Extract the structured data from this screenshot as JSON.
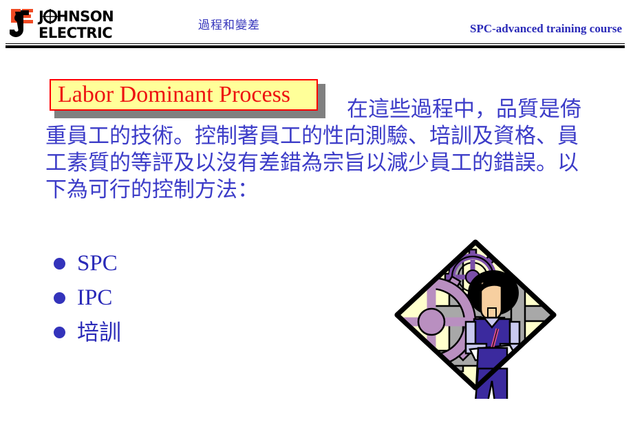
{
  "slide": {
    "header": {
      "logo_name": "johnson-electric-logo",
      "logo_line1": "JOHNSON",
      "logo_line2": "ELECTRIC",
      "center_title": "過程和變差",
      "right_title": "SPC-advanced training course"
    },
    "title": {
      "text": "Labor Dominant Process",
      "text_color": "#ee1111",
      "box_fill": "#ffff99",
      "box_border": "#ff0000",
      "shadow_color": "#808080"
    },
    "body": {
      "paragraph": "在這些過程中，品質是倚重員工的技術。控制著員工的性向測驗、培訓及資格、員工素質的等評及以沒有差錯為宗旨以減少員工的錯誤。以下為可行的控制方法：",
      "text_color": "#3c3cc8"
    },
    "bullets": {
      "marker_color": "#3333bb",
      "items": [
        {
          "label": "SPC",
          "cjk": false
        },
        {
          "label": "IPC",
          "cjk": false
        },
        {
          "label": "培訓",
          "cjk": true
        }
      ]
    },
    "clipart": {
      "name": "worker-with-clipboard-and-gears",
      "background": "#ffffcc",
      "gear_large_color": "#b98fc0",
      "gear_small_color": "#7b4fa8",
      "bar_color": "#a8a8a8",
      "person_vest_color": "#3b2a9e",
      "person_pants_color": "#3b2a9e",
      "person_shirt_color": "#c9c9ef",
      "person_skin_color": "#f7cfa0",
      "person_hair_color": "#000000"
    }
  }
}
